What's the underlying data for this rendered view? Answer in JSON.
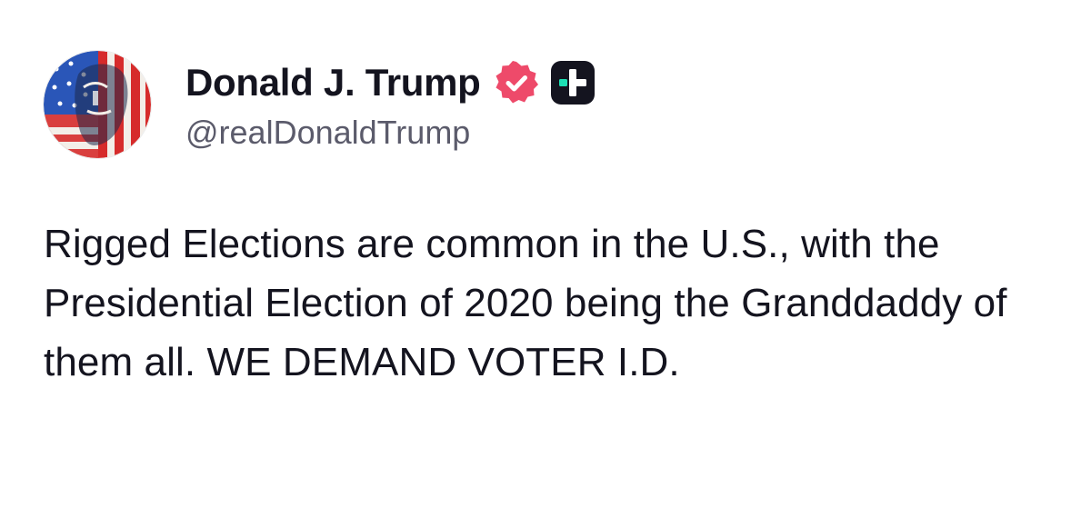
{
  "post": {
    "author": {
      "display_name": "Donald J. Trump",
      "handle": "@realDonaldTrump",
      "avatar_icon": "avatar-flag-portrait",
      "verified_icon": "verified-badge-icon",
      "verified_color": "#ee4a6a",
      "plus_icon": "plus-badge-icon",
      "plus_accent_color": "#1ce0b4"
    },
    "text": "Rigged Elections are common in the U.S., with the Presidential Election of 2020 being the Granddaddy of them all. WE DEMAND VOTER I.D."
  }
}
